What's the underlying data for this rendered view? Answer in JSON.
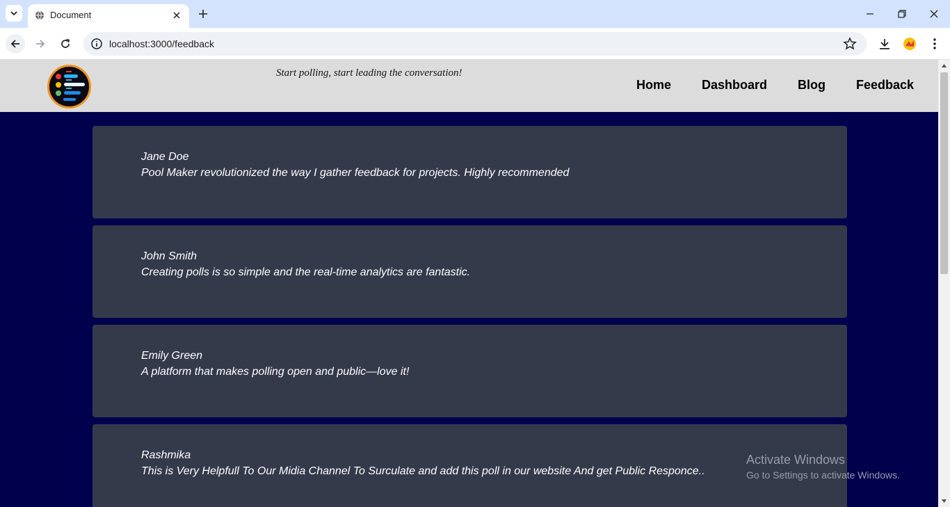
{
  "browser": {
    "tab_title": "Document",
    "url": "localhost:3000/feedback"
  },
  "header": {
    "tagline": "Start polling, start leading the conversation!",
    "nav": [
      "Home",
      "Dashboard",
      "Blog",
      "Feedback"
    ]
  },
  "feedback": [
    {
      "name": "Jane Doe",
      "text": "Pool Maker revolutionized the way I gather feedback for projects. Highly recommended"
    },
    {
      "name": "John Smith",
      "text": "Creating polls is so simple and the real-time analytics are fantastic."
    },
    {
      "name": "Emily Green",
      "text": "A platform that makes polling open and public—love it!"
    },
    {
      "name": "Rashmika",
      "text": "This is Very Helpfull To Our Midia Channel To Surculate and add this poll in our website And get Public Responce.."
    }
  ],
  "watermark": {
    "line1": "Activate Windows",
    "line2": "Go to Settings to activate Windows."
  },
  "colors": {
    "page_bg": "#00004d",
    "card_bg": "#353a4b",
    "header_bg": "#dcdcdc"
  }
}
